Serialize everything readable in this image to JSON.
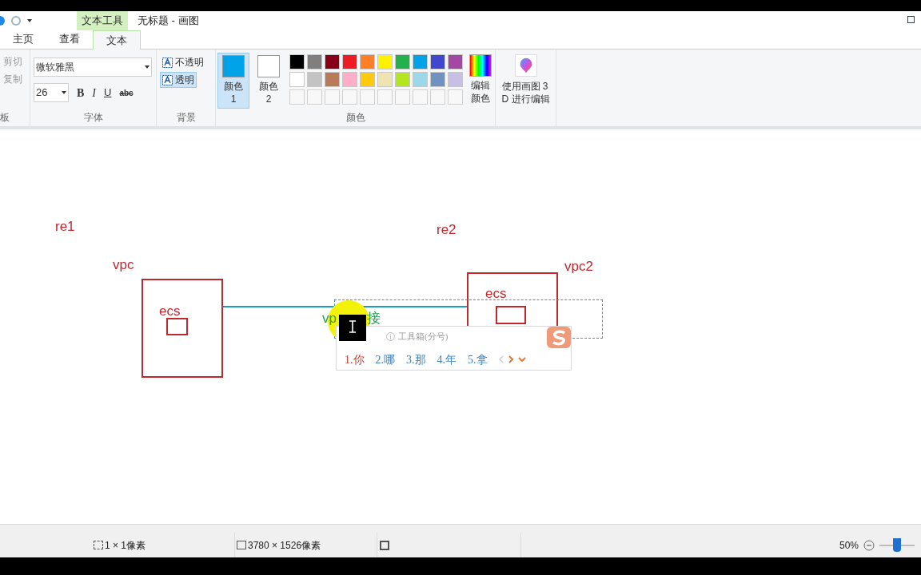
{
  "window": {
    "title": "无标题 - 画图",
    "context_tab": "文本工具"
  },
  "tabs": [
    {
      "label": "主页",
      "selected": false
    },
    {
      "label": "查看",
      "selected": false
    },
    {
      "label": "文本",
      "selected": true
    }
  ],
  "ribbon": {
    "clipboard": {
      "items": [
        "剪切",
        "复制"
      ],
      "label": "板"
    },
    "font": {
      "family": "微软雅黑",
      "size": "26",
      "styles": [
        "B",
        "I",
        "U",
        "abc"
      ],
      "label": "字体"
    },
    "background": {
      "options": [
        {
          "label": "不透明",
          "selected": false
        },
        {
          "label": "透明",
          "selected": true
        }
      ],
      "label": "背景"
    },
    "colors": {
      "label": "颜色",
      "slots": [
        {
          "label": "颜色 1",
          "color": "#00a2e8",
          "selected": true
        },
        {
          "label": "颜色 2",
          "color": "#ffffff",
          "selected": false
        }
      ],
      "palette": [
        [
          {
            "color": "#000000"
          },
          {
            "color": "#7f7f7f"
          },
          {
            "color": "#880015"
          },
          {
            "color": "#ed1c24"
          },
          {
            "color": "#ff7f27"
          },
          {
            "color": "#fff200"
          },
          {
            "color": "#22b14c"
          },
          {
            "color": "#00a2e8"
          },
          {
            "color": "#3f48cc"
          },
          {
            "color": "#a349a4"
          }
        ],
        [
          {
            "color": "#ffffff"
          },
          {
            "color": "#c3c3c3"
          },
          {
            "color": "#b97a57"
          },
          {
            "color": "#ffaec9"
          },
          {
            "color": "#ffc90e"
          },
          {
            "color": "#efe4b0"
          },
          {
            "color": "#b5e61d"
          },
          {
            "color": "#99d9ea"
          },
          {
            "color": "#7092be"
          },
          {
            "color": "#c8bfe7"
          }
        ]
      ],
      "edit": "编辑颜色"
    },
    "paint3d": "使用画图 3\nD 进行编辑"
  },
  "canvas": {
    "labels": [
      "re1",
      "vpc",
      "re2",
      "vpc2",
      "ecs",
      "ecs"
    ],
    "typed": [
      "vp",
      "接"
    ],
    "ime": {
      "hint": "工具箱(分号)",
      "candidates": [
        {
          "label": "1.你",
          "selected": true
        },
        {
          "label": "2.哪",
          "selected": false
        },
        {
          "label": "3.那",
          "selected": false
        },
        {
          "label": "4.年",
          "selected": false
        },
        {
          "label": "5.拿",
          "selected": false
        }
      ]
    }
  },
  "status_bar": {
    "selection": "1 × 1像素",
    "size": "3780 × 1526像素",
    "zoom": "50%",
    "level": 0.5
  }
}
